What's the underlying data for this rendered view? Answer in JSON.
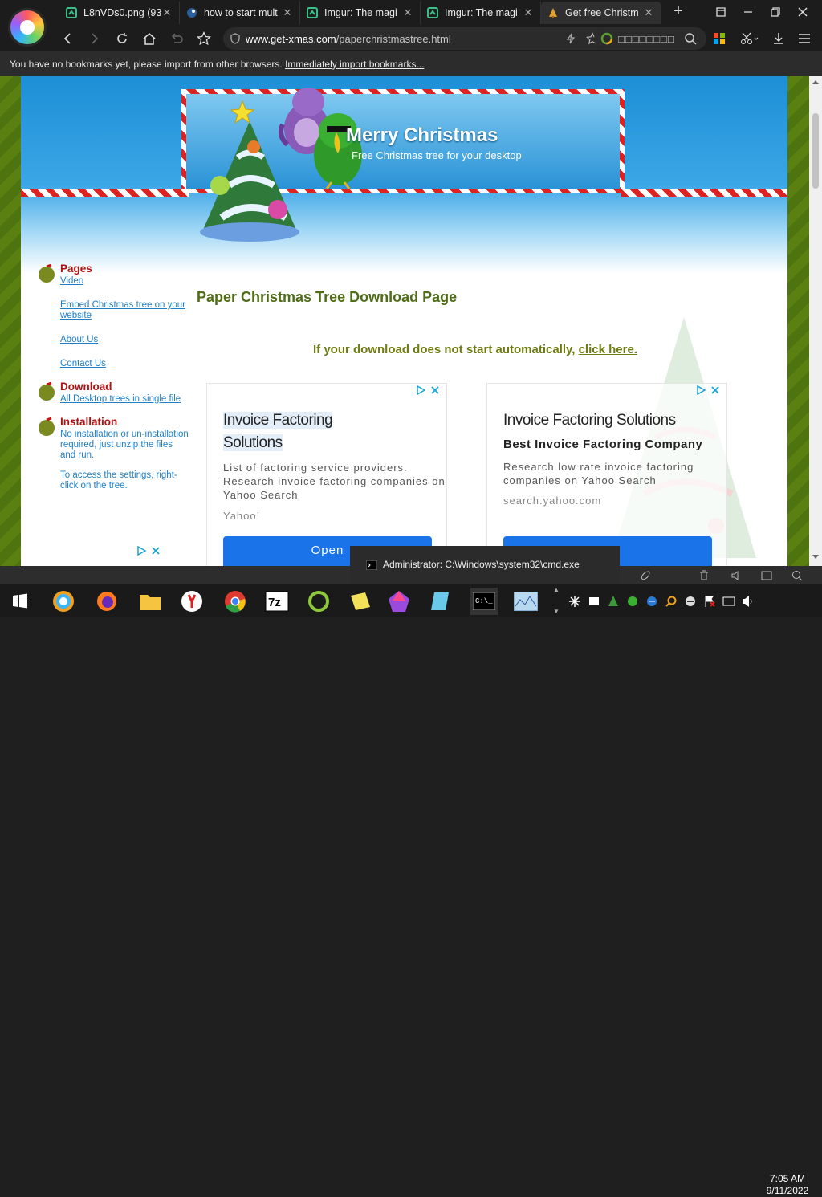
{
  "browser": {
    "tabs": [
      {
        "title": "L8nVDs0.png (93",
        "icon": "imgur-icon",
        "active": false
      },
      {
        "title": "how to start mult",
        "icon": "steam-icon",
        "active": false
      },
      {
        "title": "Imgur: The magi",
        "icon": "imgur-icon",
        "active": false
      },
      {
        "title": "Imgur: The magi",
        "icon": "imgur-icon",
        "active": false
      },
      {
        "title": "Get free Christm",
        "icon": "christmas-tree-icon",
        "active": true
      }
    ],
    "address": {
      "domain": "www.get-xmas.com",
      "path": "/paperchristmastree.html"
    },
    "search_placeholder": "□□□□□□□□",
    "bookmark_bar": {
      "text": "You have no bookmarks yet, please import from other browsers. ",
      "link": "Immediately import bookmarks..."
    }
  },
  "site": {
    "title": "Merry Christmas",
    "subtitle": "Free Christmas tree for your desktop"
  },
  "sidebar": {
    "groups": [
      {
        "heading": "Pages",
        "links": [
          "Video",
          "Embed Christmas tree on your website",
          "About Us",
          "Contact Us"
        ],
        "notes": []
      },
      {
        "heading": "Download",
        "links": [
          "All Desktop trees in single file"
        ],
        "notes": []
      },
      {
        "heading": "Installation",
        "links": [],
        "notes": [
          "No installation or un-installation required, just unzip the files and run.",
          "To access the settings, right-click on the tree."
        ]
      }
    ]
  },
  "main": {
    "title": "Paper Christmas Tree Download Page",
    "download_note": "If your download does not start automatically, ",
    "download_link": "click here."
  },
  "ads": [
    {
      "title_line1": "Invoice Factoring",
      "title_line2": "Solutions",
      "subtitle": "",
      "description": "List of factoring service providers. Research invoice factoring companies on Yahoo Search",
      "source": "Yahoo!",
      "button": "Open"
    },
    {
      "title_line1": "Invoice Factoring Solutions",
      "title_line2": "",
      "subtitle": "Best Invoice Factoring Company",
      "description": "Research low rate invoice factoring companies on Yahoo Search",
      "source": "search.yahoo.com",
      "button": ""
    }
  ],
  "os": {
    "cmd_window_title": "Administrator: C:\\Windows\\system32\\cmd.exe",
    "time": "7:05 AM",
    "date": "9/11/2022"
  },
  "colors": {
    "accent_blue": "#1a73e8",
    "page_green": "#5a8012",
    "heading_red": "#b01010",
    "link_blue": "#1f80c9"
  }
}
